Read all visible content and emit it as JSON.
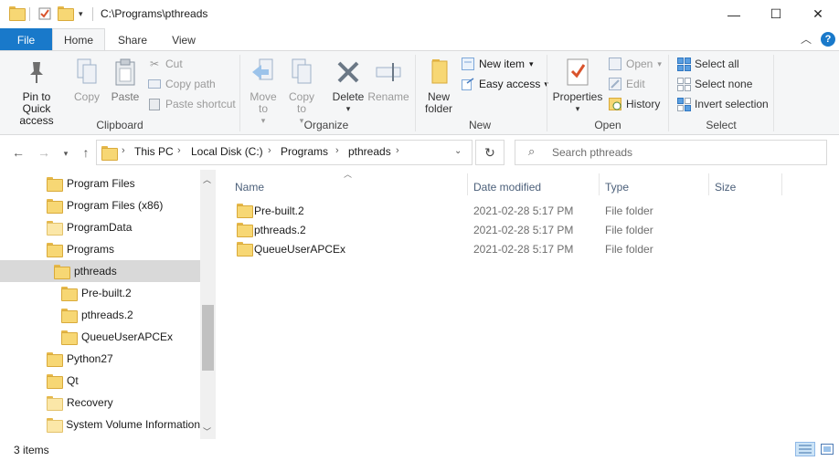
{
  "window": {
    "path_title": "C:\\Programs\\pthreads"
  },
  "tabs": {
    "file": "File",
    "home": "Home",
    "share": "Share",
    "view": "View"
  },
  "ribbon": {
    "clipboard": {
      "label": "Clipboard",
      "pin": "Pin to Quick access",
      "copy": "Copy",
      "paste": "Paste",
      "cut": "Cut",
      "copy_path": "Copy path",
      "paste_shortcut": "Paste shortcut"
    },
    "organize": {
      "label": "Organize",
      "move_to": "Move to",
      "copy_to": "Copy to",
      "delete": "Delete",
      "rename": "Rename"
    },
    "new": {
      "label": "New",
      "new_folder": "New folder",
      "new_item": "New item",
      "easy_access": "Easy access"
    },
    "open": {
      "label": "Open",
      "properties": "Properties",
      "open": "Open",
      "edit": "Edit",
      "history": "History"
    },
    "select": {
      "label": "Select",
      "select_all": "Select all",
      "select_none": "Select none",
      "invert": "Invert selection"
    }
  },
  "address": {
    "crumbs": [
      "This PC",
      "Local Disk (C:)",
      "Programs",
      "pthreads"
    ],
    "search_placeholder": "Search pthreads"
  },
  "nav": {
    "items": [
      "Program Files",
      "Program Files (x86)",
      "ProgramData",
      "Programs",
      "pthreads",
      "Pre-built.2",
      "pthreads.2",
      "QueueUserAPCEx",
      "Python27",
      "Qt",
      "Recovery",
      "System Volume Information"
    ]
  },
  "columns": {
    "name": "Name",
    "date": "Date modified",
    "type": "Type",
    "size": "Size"
  },
  "files": [
    {
      "name": "Pre-built.2",
      "date": "2021-02-28 5:17 PM",
      "type": "File folder"
    },
    {
      "name": "pthreads.2",
      "date": "2021-02-28 5:17 PM",
      "type": "File folder"
    },
    {
      "name": "QueueUserAPCEx",
      "date": "2021-02-28 5:17 PM",
      "type": "File folder"
    }
  ],
  "status": {
    "count": "3 items"
  },
  "colors": {
    "accent": "#1979ca",
    "folder": "#f7d774",
    "selected_bg": "#d9d9d9"
  }
}
